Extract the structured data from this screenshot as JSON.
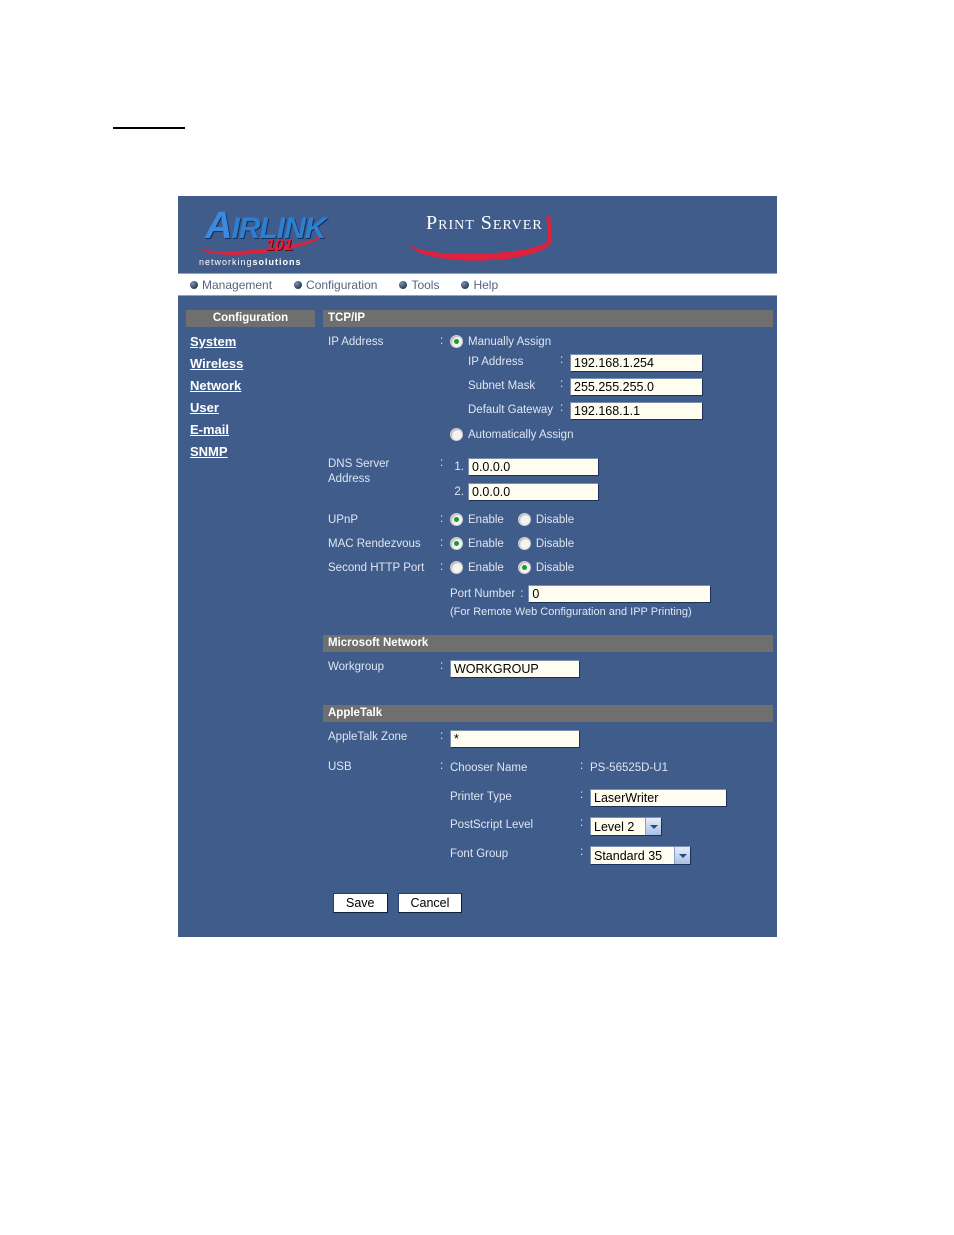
{
  "brand": {
    "logo_main": "IRL",
    "logo_main_k": "INK",
    "logo_cap": "A",
    "logo_sub": "101",
    "tagline_light": "networking",
    "tagline_bold": "solutions",
    "product_title": "Print Server"
  },
  "nav": {
    "items": [
      {
        "label": "Management"
      },
      {
        "label": "Configuration"
      },
      {
        "label": "Tools"
      },
      {
        "label": "Help"
      }
    ]
  },
  "sidebar": {
    "header": "Configuration",
    "items": [
      {
        "label": "System"
      },
      {
        "label": "Wireless"
      },
      {
        "label": "Network"
      },
      {
        "label": "User"
      },
      {
        "label": "E-mail"
      },
      {
        "label": "SNMP"
      }
    ]
  },
  "tcpip": {
    "section_title": "TCP/IP",
    "ip_address_label": "IP Address",
    "manually_assign_label": "Manually Assign",
    "automatically_assign_label": "Automatically Assign",
    "assign_mode": "manual",
    "ip_address_sub_label": "IP Address",
    "ip_address_value": "192.168.1.254",
    "subnet_mask_label": "Subnet Mask",
    "subnet_mask_value": "255.255.255.0",
    "default_gateway_label": "Default Gateway",
    "default_gateway_value": "192.168.1.1",
    "dns_label_line1": "DNS Server",
    "dns_label_line2": "Address",
    "dns_1_index": "1.",
    "dns_1_value": "0.0.0.0",
    "dns_2_index": "2.",
    "dns_2_value": "0.0.0.0",
    "upnp_label": "UPnP",
    "upnp_value": "Enable",
    "mac_rendezvous_label": "MAC Rendezvous",
    "mac_rendezvous_value": "Enable",
    "second_http_label": "Second HTTP Port",
    "second_http_value": "Disable",
    "enable_label": "Enable",
    "disable_label": "Disable",
    "port_number_label": "Port Number",
    "port_number_value": "0",
    "port_note": "(For Remote Web Configuration and IPP Printing)"
  },
  "microsoft_network": {
    "section_title": "Microsoft Network",
    "workgroup_label": "Workgroup",
    "workgroup_value": "WORKGROUP"
  },
  "appletalk": {
    "section_title": "AppleTalk",
    "zone_label": "AppleTalk Zone",
    "zone_value": "*",
    "usb_label": "USB",
    "chooser_name_label": "Chooser Name",
    "chooser_name_value": "PS-56525D-U1",
    "printer_type_label": "Printer Type",
    "printer_type_value": "LaserWriter",
    "postscript_level_label": "PostScript Level",
    "postscript_level_value": "Level 2",
    "font_group_label": "Font Group",
    "font_group_value": "Standard 35"
  },
  "actions": {
    "save_label": "Save",
    "cancel_label": "Cancel"
  },
  "colors": {
    "panel_bg": "#405C8B",
    "section_header": "#6F6F6F",
    "input_bg": "#FFFDF0",
    "brand_red": "#E0213C",
    "brand_blue": "#3C8AE0",
    "radio_on": "#1A9B2E"
  }
}
